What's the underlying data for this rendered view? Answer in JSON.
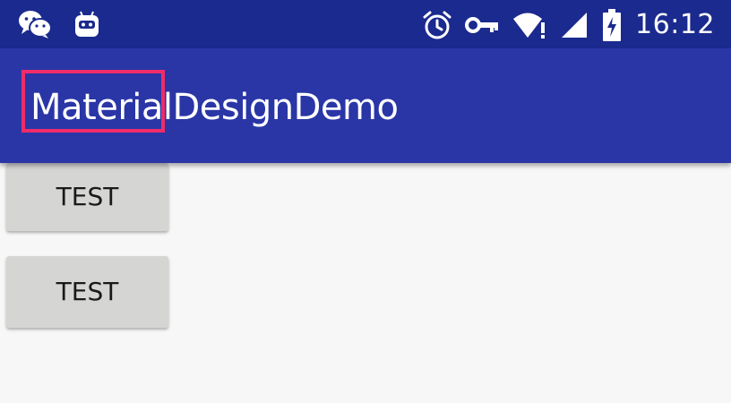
{
  "status_bar": {
    "time": "16:12",
    "icons": [
      "wechat-icon",
      "android-robot-icon",
      "alarm-icon",
      "vpn-key-icon",
      "wifi-icon",
      "signal-icon",
      "battery-charging-icon"
    ]
  },
  "app_bar": {
    "title": "MaterialDesignDemo"
  },
  "buttons": [
    {
      "label": "TEST"
    },
    {
      "label": "TEST"
    }
  ],
  "colors": {
    "status_bar": "#1b2a8e",
    "app_bar": "#2a36a6",
    "highlight": "#ee2d6a",
    "button": "#d5d5d4",
    "background": "#f7f7f7"
  }
}
